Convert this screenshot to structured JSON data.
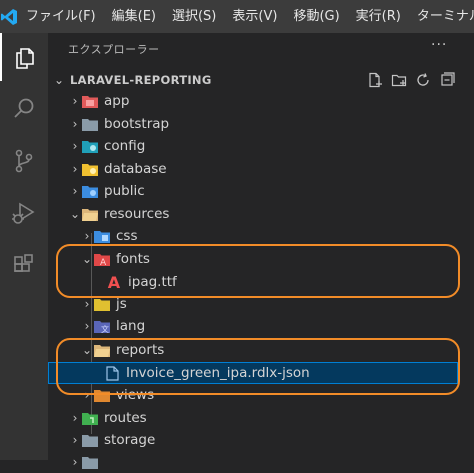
{
  "menubar": {
    "items": [
      "ファイル(F)",
      "編集(E)",
      "選択(S)",
      "表示(V)",
      "移動(G)",
      "実行(R)",
      "ターミナル"
    ]
  },
  "activity": {
    "icons": [
      "files-icon",
      "search-icon",
      "source-control-icon",
      "run-debug-icon",
      "extensions-icon"
    ]
  },
  "explorer": {
    "header": "エクスプローラー",
    "more": "···",
    "project": "LARAVEL-REPORTING",
    "tree": [
      {
        "label": "app"
      },
      {
        "label": "bootstrap"
      },
      {
        "label": "config"
      },
      {
        "label": "database"
      },
      {
        "label": "public"
      },
      {
        "label": "resources"
      },
      {
        "label": "css"
      },
      {
        "label": "fonts"
      },
      {
        "label": "ipag.ttf"
      },
      {
        "label": "js"
      },
      {
        "label": "lang"
      },
      {
        "label": "reports"
      },
      {
        "label": "Invoice_green_ipa.rdlx-json"
      },
      {
        "label": "views"
      },
      {
        "label": "routes"
      },
      {
        "label": "storage"
      }
    ]
  },
  "colors": {
    "accent": "#007fd4",
    "selected_bg": "#04395e",
    "annotation": "#f28c28",
    "folder": "#dcb67a"
  }
}
